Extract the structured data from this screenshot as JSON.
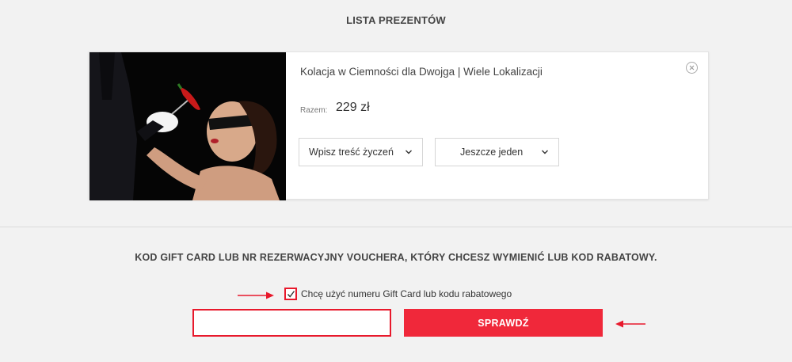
{
  "gift_list": {
    "title": "LISTA PREZENTÓW",
    "item": {
      "name": "Kolacja w Ciemności dla Dwojga | Wiele Lokalizacji",
      "price_label": "Razem:",
      "price": "229 zł",
      "wishes_select": "Wpisz treść życzeń",
      "another_select": "Jeszcze jeden"
    }
  },
  "voucher": {
    "heading": "KOD GIFT CARD LUB NR REZERWACYJNY VOUCHERA, KTÓRY CHCESZ WYMIENIĆ LUB KOD RABATOWY.",
    "checkbox_label": "Chcę użyć numeru Gift Card lub kodu rabatowego",
    "checkbox_checked": true,
    "input_value": "",
    "button_label": "SPRAWDŹ"
  },
  "colors": {
    "accent": "#f0283a",
    "highlight": "#e8192c",
    "background": "#f2f2f2"
  },
  "icons": [
    "close-circle-icon",
    "chevron-down-icon",
    "checkmark-icon",
    "arrow-right-icon",
    "arrow-left-icon"
  ]
}
